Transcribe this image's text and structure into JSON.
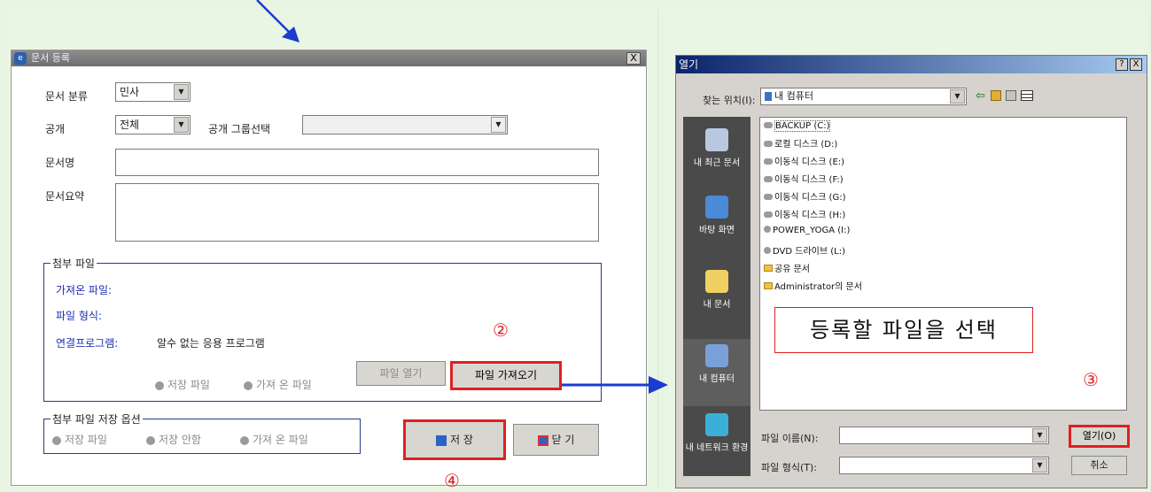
{
  "left_dialog": {
    "title": "문서 등록",
    "close_label": "X",
    "fields": {
      "category_label": "문서 분류",
      "category_value": "민사",
      "visibility_label": "공개",
      "visibility_value": "전체",
      "group_label": "공개 그룹선택",
      "docname_label": "문서명",
      "summary_label": "문서요약"
    },
    "attachment": {
      "legend": "첨부 파일",
      "imported_file_label": "가져온 파일:",
      "file_type_label": "파일 형식:",
      "program_label": "연결프로그램:",
      "program_value": "알수 없는 응용 프로그램",
      "radio_saved": "저장 파일",
      "radio_imported": "가져 온 파일",
      "open_file_label": "파일 열기",
      "import_file_label": "파일 가져오기",
      "step_mark": "②"
    },
    "save_options": {
      "legend": "첨부 파일 저장 옵션",
      "radio_save": "저장 파일",
      "radio_nosave": "저장 안함",
      "radio_imported": "가져 온 파일"
    },
    "save_label": "저 장",
    "close_btn_label": "닫 기",
    "step_mark": "④"
  },
  "right_dialog": {
    "title": "열기",
    "help_label": "?",
    "close_label": "X",
    "lookin_label": "찾는 위치(I):",
    "lookin_value": "내 컴퓨터",
    "places": [
      "내 최근 문서",
      "바탕 화면",
      "내 문서",
      "내 컴퓨터",
      "내 네트워크 환경"
    ],
    "files": [
      "BACKUP (C:)",
      "로컬 디스크 (D:)",
      "이동식 디스크 (E:)",
      "이동식 디스크 (F:)",
      "이동식 디스크 (G:)",
      "이동식 디스크 (H:)",
      "POWER_YOGA (I:)",
      "DVD 드라이브 (L:)",
      "공유 문서",
      "Administrator의 문서"
    ],
    "callout": "등록할 파일을 선택",
    "step_mark": "③",
    "filename_label": "파일 이름(N):",
    "filetype_label": "파일 형식(T):",
    "open_label": "열기(O)",
    "cancel_label": "취소"
  },
  "colors": {
    "highlight": "#e02020",
    "arrow": "#1a3cd0",
    "label_blue": "#1a2fb5"
  }
}
